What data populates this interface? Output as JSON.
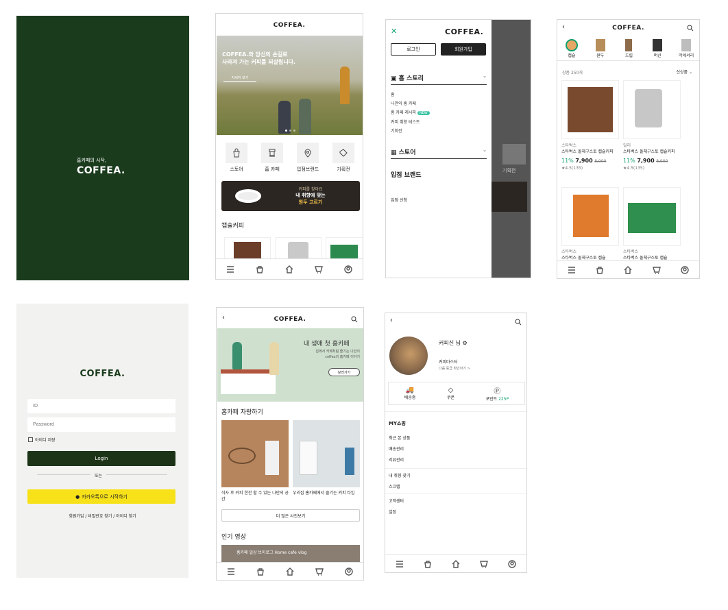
{
  "colors": {
    "brand_dark": "#1a3b1c",
    "login_btn": "#1d3318",
    "kakao": "#f7e21a",
    "teal": "#0e9f6e",
    "bg_login": "#f2f2f0"
  },
  "splash": {
    "tagline": "홈카페의 시작,",
    "logo": "COFFEA."
  },
  "home": {
    "logo": "COFFEA.",
    "hero_line1": "COFFEA.와 당신의 손길로",
    "hero_line2": "사라져 가는 커피를 되살립니다.",
    "hero_button": "자세히 보기",
    "categories": [
      {
        "label": "스토어",
        "icon": "bag-icon"
      },
      {
        "label": "홈 카페",
        "icon": "coffee-machine-icon"
      },
      {
        "label": "입점브랜드",
        "icon": "pin-icon"
      },
      {
        "label": "기획전",
        "icon": "ticket-icon"
      }
    ],
    "banner_small": "커피를 찾아요",
    "banner_line1": "내 취향에 맞는",
    "banner_line2": "원두 고르기",
    "section_title": "캡슐커피"
  },
  "menu": {
    "logo": "COFFEA.",
    "login_btn": "로그인",
    "signup_btn": "회원가입",
    "sec1_title": "홈 스토리",
    "sec1_items": [
      "홈",
      "나만의 홈 카페",
      "홈 카페 레시피",
      "커피 취향 테스트",
      "기획전"
    ],
    "new_badge": "NEW",
    "sec2_title": "스토어",
    "sec3_title": "입점 브랜드",
    "sec4_item": "입점 신청",
    "bg_label": "기획전"
  },
  "list": {
    "logo": "COFFEA.",
    "tabs": [
      "캡슐",
      "원두",
      "드립",
      "머신",
      "악세서리"
    ],
    "count_text": "상품 250개",
    "sort": "신상품",
    "products": [
      {
        "brand": "스타벅스",
        "name": "스타벅스 돌체구스토 캡슐커피",
        "discount": "11%",
        "price": "7,900",
        "old": "8,900",
        "rating": "★4.5(135)"
      },
      {
        "brand": "일리",
        "name": "스타벅스 돌체구스토 캡슐커피",
        "discount": "11%",
        "price": "7,900",
        "old": "8,900",
        "rating": "★4.5(135)"
      },
      {
        "brand": "스타벅스",
        "name": "스타벅스 돌체구스토 캡슐",
        "discount": "",
        "price": "",
        "old": "",
        "rating": ""
      },
      {
        "brand": "스타벅스",
        "name": "스타벅스 돌체구스토 캡슐",
        "discount": "",
        "price": "",
        "old": "",
        "rating": ""
      }
    ]
  },
  "login": {
    "logo": "COFFEA.",
    "id_placeholder": "ID",
    "pw_placeholder": "Password",
    "remember": "아이디 저장",
    "login_btn": "Login",
    "or": "또는",
    "kakao_btn": "카카오톡으로 시작하기",
    "footer": "회원가입 / 비밀번호 찾기 / 아이디 찾기"
  },
  "homecafe": {
    "logo": "COFFEA.",
    "banner_title": "내 생애 첫 홈카페",
    "banner_sub1": "집에서 카페처럼 즐기는 나만의",
    "banner_sub2": "coffea의 홈카페 이야기",
    "banner_btn": "보러가기",
    "section1": "홈카페 자랑하기",
    "card1_caption": "식사 후 커피 한잔 할 수 있는 나만의 공간",
    "card2_caption": "우리집 홈카페에서 즐기는 커피 타임",
    "more_btn": "더 많은 사진보기",
    "section2": "인기 영상",
    "video_title": "홈카페 일상 브이로그 Home cafe vlog"
  },
  "mypage": {
    "name": "커피신 님",
    "grade": "커피마스터",
    "grade_link": "다음 등급 확인하기 >",
    "stats": [
      {
        "label": "배송중",
        "icon": "truck-icon",
        "value": ""
      },
      {
        "label": "쿠폰",
        "icon": "coupon-icon",
        "value": ""
      },
      {
        "label": "포인트",
        "icon": "point-icon",
        "value": "225P"
      }
    ],
    "section": "MY쇼핑",
    "items1": [
      "최근 본 상품",
      "배송관리",
      "리뷰관리"
    ],
    "items2": [
      "내 취향 찾기",
      "스크랩"
    ],
    "items3": [
      "고객센터",
      "설정"
    ]
  }
}
